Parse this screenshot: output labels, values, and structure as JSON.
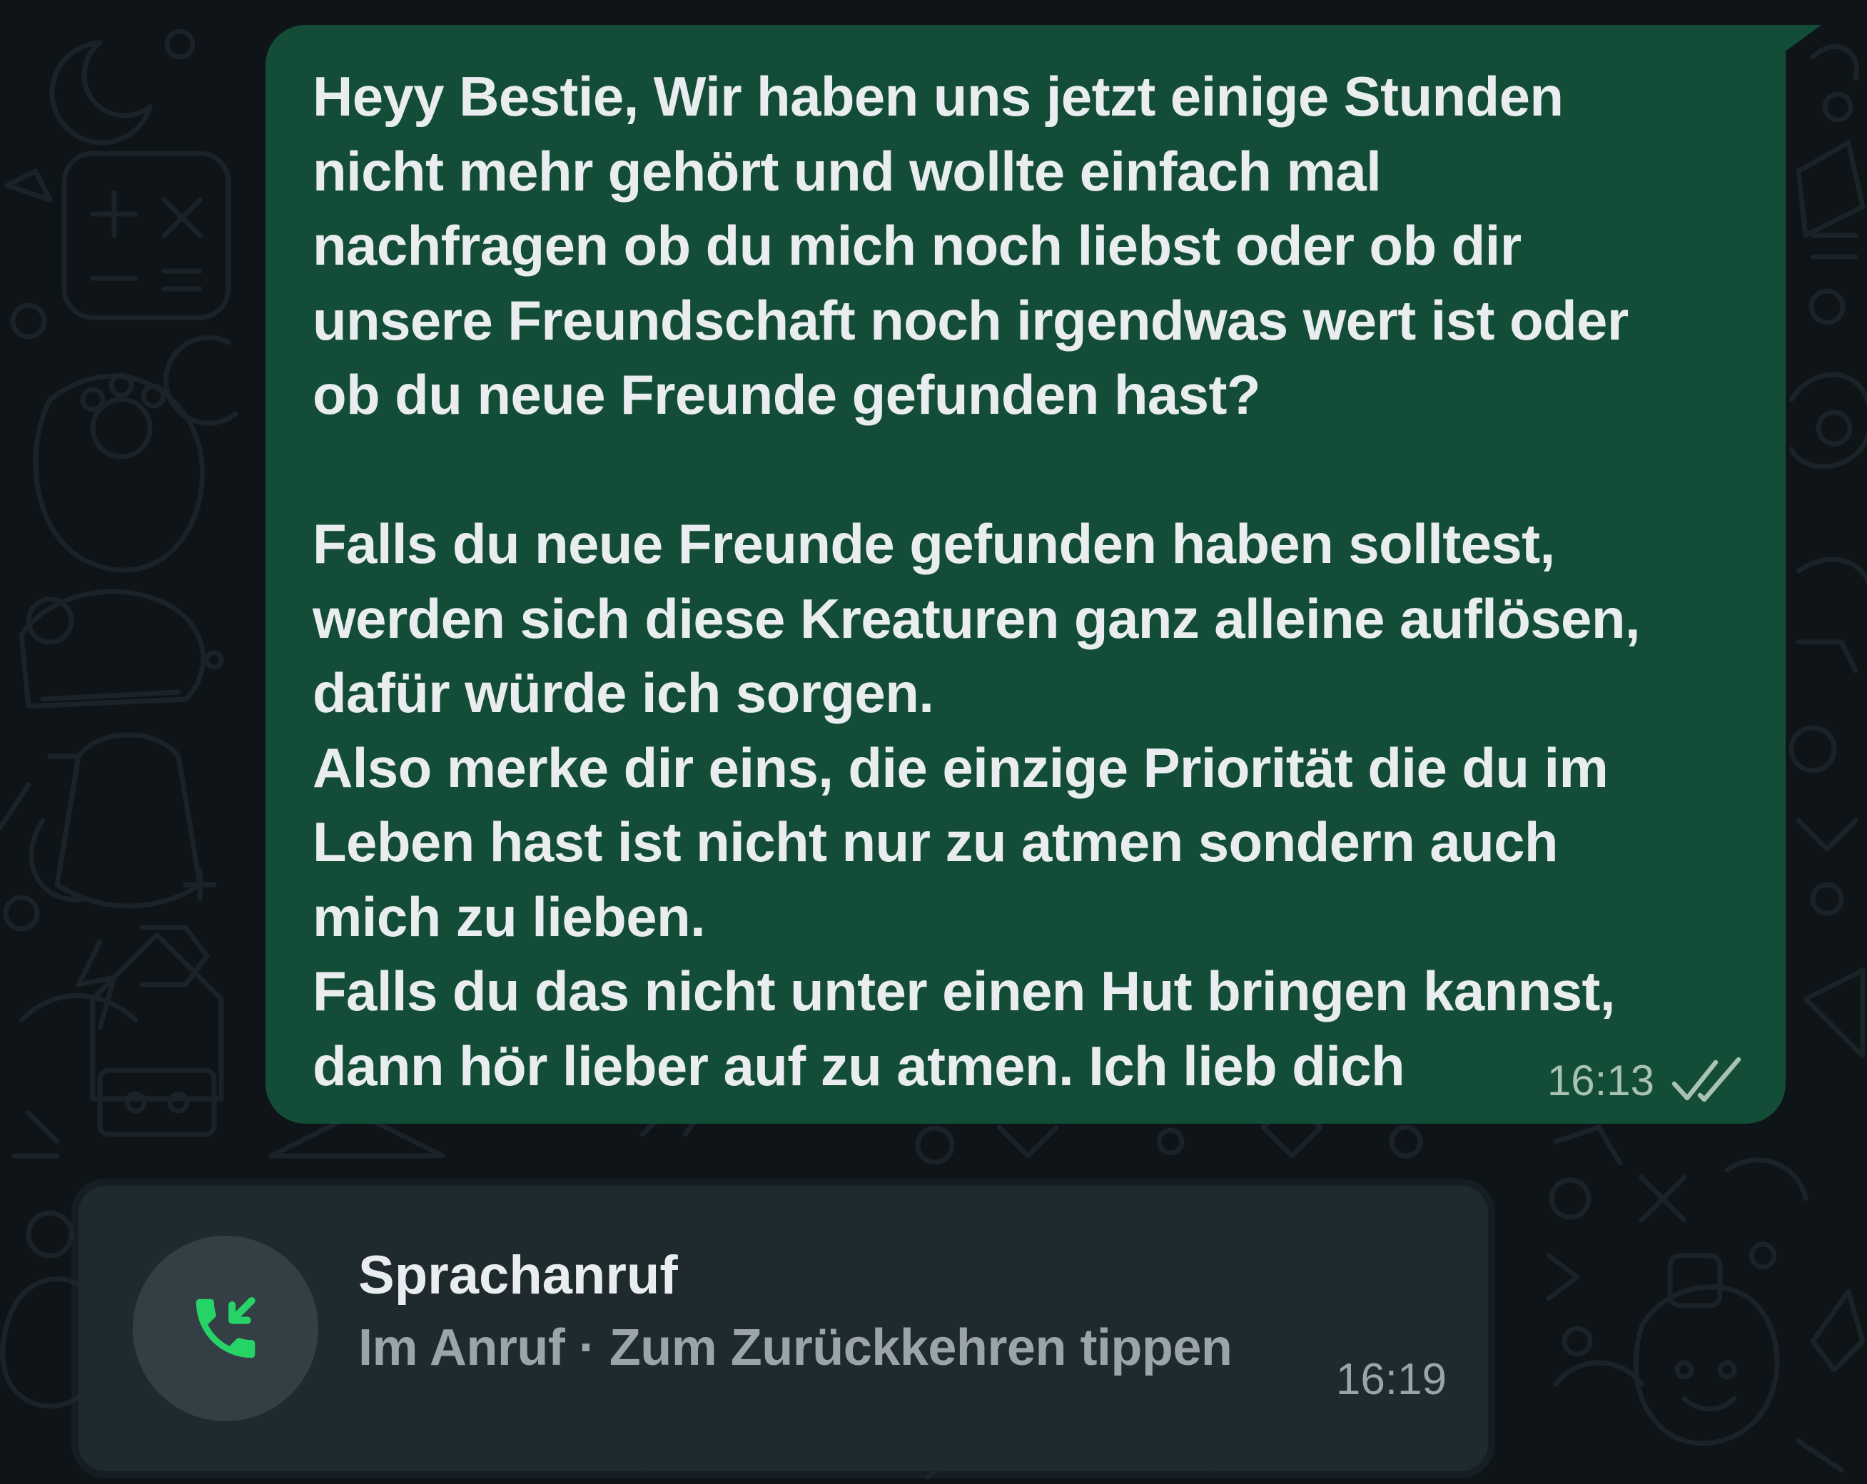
{
  "colors": {
    "background": "#0e1418",
    "outgoing_bubble": "#144d37",
    "card": "#1f2a2f",
    "call_accent": "#25d366",
    "text_primary": "#e9edef",
    "text_secondary": "#9aa4a9"
  },
  "message": {
    "text": "Heyy Bestie, Wir haben uns jetzt einige Stunden\nnicht mehr gehört und wollte einfach mal\nnachfragen ob du mich noch liebst oder ob dir\nunsere Freundschaft noch irgendwas wert ist oder\nob du neue Freunde gefunden hast?\n\nFalls du neue Freunde gefunden haben solltest,\nwerden sich diese Kreaturen ganz alleine auflösen,\ndafür würde ich sorgen.\nAlso merke dir eins, die einzige Priorität die du im\nLeben hast ist nicht nur zu atmen sondern auch\nmich zu lieben.\nFalls du das nicht unter einen Hut bringen kannst,\ndann hör lieber auf zu atmen. Ich lieb dich",
    "time": "16:13",
    "status_icon": "double-check-icon"
  },
  "call": {
    "title": "Sprachanruf",
    "subtitle": "Im Anruf · Zum Zurückkehren tippen",
    "time": "16:19",
    "icon": "incoming-call-icon"
  }
}
